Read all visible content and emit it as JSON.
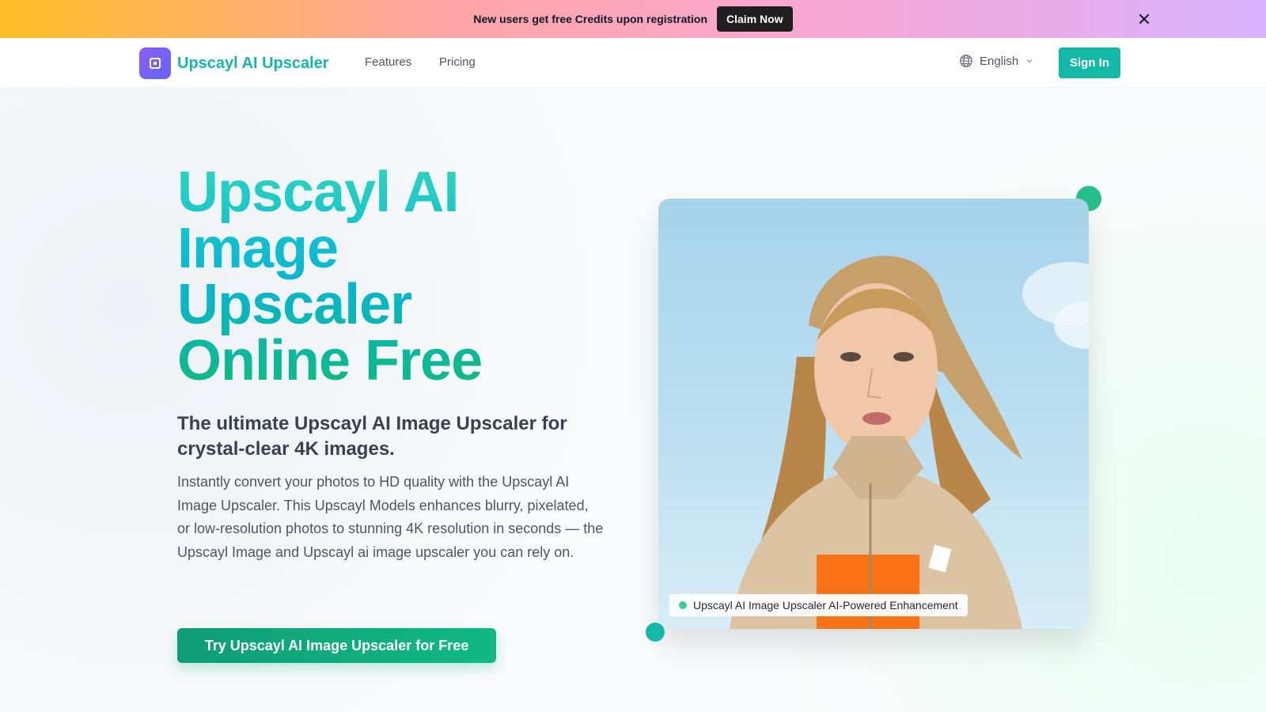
{
  "promo": {
    "text": "New users get free Credits upon registration",
    "button_label": "Claim Now",
    "close_icon": "close-icon"
  },
  "nav": {
    "brand": "Upscayl AI Upscaler",
    "links": [
      "Features",
      "Pricing"
    ],
    "language": "English",
    "sign_in_label": "Sign In"
  },
  "hero": {
    "title_lines": [
      "Upscayl AI",
      "Image",
      "Upscaler",
      "Online Free"
    ],
    "subtitle": "The ultimate Upscayl AI Image Upscaler for crystal-clear 4K images.",
    "description": "Instantly convert your photos to HD quality with the Upscayl AI Image Upscaler. This Upscayl Models enhances blurry, pixelated, or low-resolution photos to stunning 4K resolution in seconds — the Upscayl Image and Upscayl ai image upscaler you can rely on.",
    "cta_label": "Try Upscayl AI Image Upscaler for Free",
    "image_caption": "Upscayl AI Image Upscaler AI-Powered Enhancement"
  },
  "colors": {
    "accent": "#14b8a6",
    "brand_purple": "#7c3aed",
    "cta_green": "#10b981"
  }
}
